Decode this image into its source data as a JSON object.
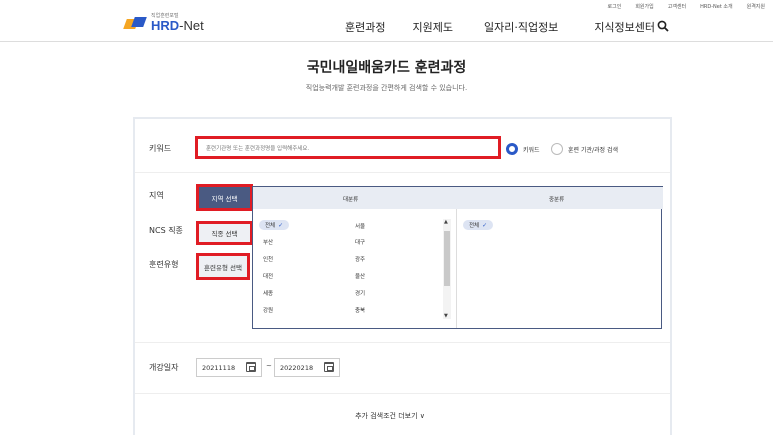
{
  "utility": [
    "로그인",
    "회원가입",
    "고객센터",
    "HRD-Net 소개",
    "원격지원"
  ],
  "logo": {
    "small": "직업훈련포털",
    "brand_main": "HRD",
    "brand_sep": "-Net"
  },
  "gnb": [
    "훈련과정",
    "지원제도",
    "일자리·직업정보",
    "지식정보센터"
  ],
  "page": {
    "title": "국민내일배움카드 훈련과정",
    "subtitle": "직업능력개발 훈련과정을 간편하게 검색할 수 있습니다."
  },
  "keyword": {
    "label": "키워드",
    "placeholder": "훈련기관명 또는 훈련과정명을 입력해주세요.",
    "radio_keyword": "키워드",
    "radio_org": "훈련 기관/과정 검색"
  },
  "filters": {
    "region_label": "지역",
    "region_button": "지역 선택",
    "ncs_label": "NCS 직종",
    "ncs_button": "직종 선택",
    "type_label": "훈련유형",
    "type_button": "훈련유형 선택"
  },
  "picker": {
    "major_header": "대분류",
    "minor_header": "중분류",
    "all_chip": "전체",
    "minor_chip": "전체",
    "col1": [
      "부산",
      "인천",
      "대전",
      "세종",
      "강원"
    ],
    "col2": [
      "서울",
      "대구",
      "광주",
      "울산",
      "경기",
      "충북"
    ]
  },
  "dates": {
    "label": "개강일자",
    "start": "20211118",
    "end": "20220218",
    "sep": "~"
  },
  "more": "추가 검색조건 더보기 ∨",
  "colors": {
    "brand": "#2a59c7",
    "highlight": "#e01c24",
    "region_button": "#4a5a82"
  }
}
